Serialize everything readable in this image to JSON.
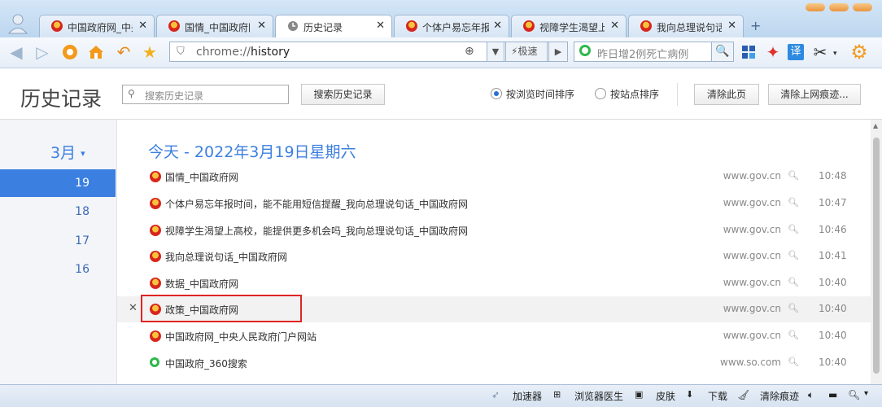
{
  "tabs": [
    {
      "label": "中国政府网_中央人民政府门户网站",
      "icon": "gov-emblem-icon"
    },
    {
      "label": "国情_中国政府网",
      "icon": "gov-emblem-icon"
    },
    {
      "label": "历史记录",
      "icon": "history-clock-icon",
      "active": true
    },
    {
      "label": "个体户易忘年报时间，能不能用短信提醒",
      "icon": "gov-emblem-icon"
    },
    {
      "label": "视障学生渴望上高校，能提供更多机会吗",
      "icon": "gov-emblem-icon"
    },
    {
      "label": "我向总理说句话_中国政府网",
      "icon": "gov-emblem-icon"
    }
  ],
  "toolbar": {
    "address_prefix": "chrome://",
    "address_path": "history",
    "speed_label": "极速",
    "search_placeholder": "昨日增2例死亡病例",
    "translate_label": "译"
  },
  "header": {
    "title": "历史记录",
    "search_placeholder": "搜索历史记录",
    "search_button": "搜索历史记录",
    "sort_by_time": "按浏览时间排序",
    "sort_by_site": "按站点排序",
    "clear_page": "清除此页",
    "clear_traces": "清除上网痕迹..."
  },
  "sidebar": {
    "month": "3月",
    "days": [
      "19",
      "18",
      "17",
      "16"
    ],
    "selected_day": "19"
  },
  "main": {
    "date_heading": "今天 - 2022年3月19日星期六",
    "entries": [
      {
        "title": "国情_中国政府网",
        "domain": "www.gov.cn",
        "time": "10:48",
        "icon": "gov-emblem-icon"
      },
      {
        "title": "个体户易忘年报时间，能不能用短信提醒_我向总理说句话_中国政府网",
        "domain": "www.gov.cn",
        "time": "10:47",
        "icon": "gov-emblem-icon"
      },
      {
        "title": "视障学生渴望上高校，能提供更多机会吗_我向总理说句话_中国政府网",
        "domain": "www.gov.cn",
        "time": "10:46",
        "icon": "gov-emblem-icon"
      },
      {
        "title": "我向总理说句话_中国政府网",
        "domain": "www.gov.cn",
        "time": "10:41",
        "icon": "gov-emblem-icon"
      },
      {
        "title": "数据_中国政府网",
        "domain": "www.gov.cn",
        "time": "10:40",
        "icon": "gov-emblem-icon"
      },
      {
        "title": "政策_中国政府网",
        "domain": "www.gov.cn",
        "time": "10:40",
        "icon": "gov-emblem-icon",
        "highlighted": true
      },
      {
        "title": "中国政府网_中央人民政府门户网站",
        "domain": "www.gov.cn",
        "time": "10:40",
        "icon": "gov-emblem-icon"
      },
      {
        "title": "中国政府_360搜索",
        "domain": "www.so.com",
        "time": "10:40",
        "icon": "360-search-icon"
      }
    ]
  },
  "statusbar": {
    "accelerator": "加速器",
    "doctor": "浏览器医生",
    "skin": "皮肤",
    "download": "下载",
    "clear_traces": "清除痕迹"
  },
  "colors": {
    "accent": "#3b7fe0",
    "highlight_box": "#e02424"
  }
}
